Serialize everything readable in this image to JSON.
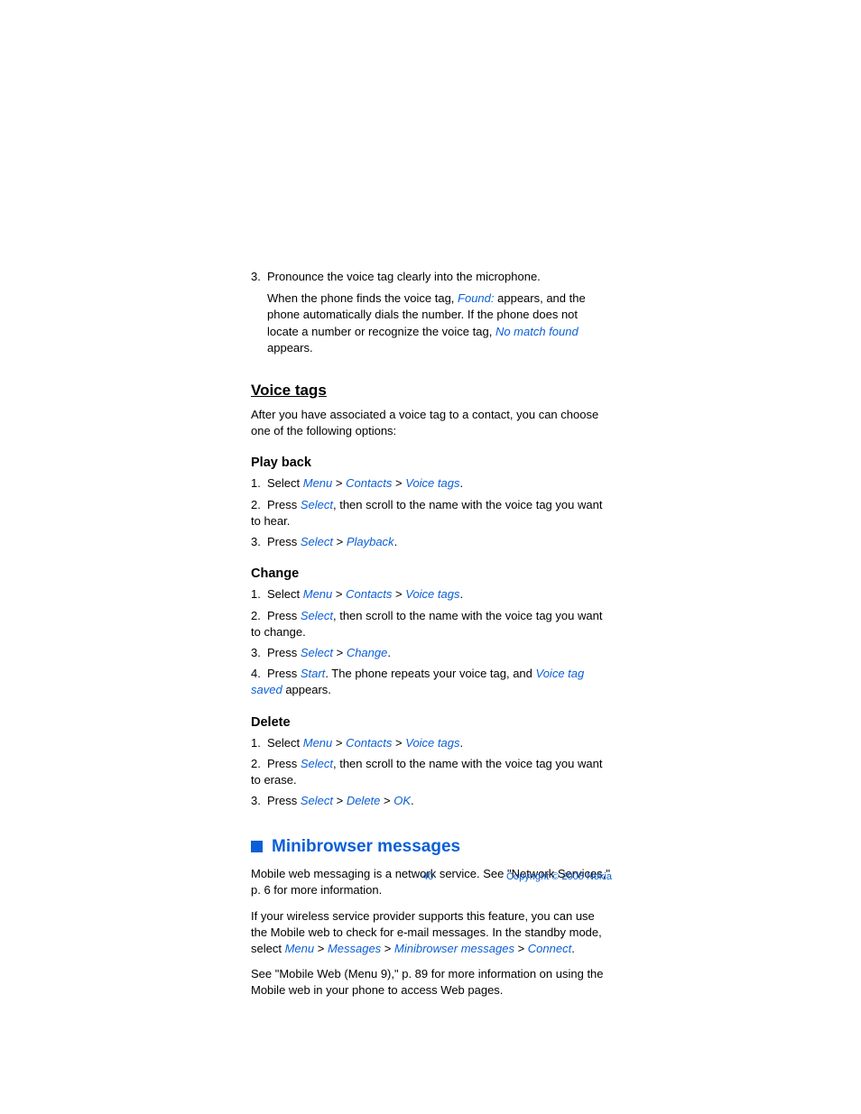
{
  "step3": {
    "num": "3.",
    "text": "Pronounce the voice tag clearly into the microphone.",
    "body_a": "When the phone finds the voice tag, ",
    "found": "Found:",
    "body_b": " appears, and the phone automatically dials the number. If the phone does not locate a number or recognize the voice tag, ",
    "nomatch": "No match found",
    "body_c": " appears."
  },
  "voice_tags": {
    "heading": "Voice tags",
    "intro": "After you have associated a voice tag to a contact, you can choose one of the following options:"
  },
  "playback": {
    "heading": "Play back",
    "s1": {
      "num": "1.",
      "a": "Select ",
      "menu": "Menu",
      "gt1": " > ",
      "contacts": "Contacts",
      "gt2": " > ",
      "vt": "Voice tags",
      "dot": "."
    },
    "s2": {
      "num": "2.",
      "a": "Press ",
      "sel": "Select",
      "b": ", then scroll to the name with the voice tag you want to hear."
    },
    "s3": {
      "num": "3.",
      "a": "Press ",
      "sel": "Select",
      "gt": " > ",
      "pb": "Playback",
      "dot": "."
    }
  },
  "change": {
    "heading": "Change",
    "s1": {
      "num": "1.",
      "a": "Select ",
      "menu": "Menu",
      "gt1": " > ",
      "contacts": "Contacts",
      "gt2": " > ",
      "vt": "Voice tags",
      "dot": "."
    },
    "s2": {
      "num": "2.",
      "a": "Press ",
      "sel": "Select",
      "b": ", then scroll to the name with the voice tag you want to change."
    },
    "s3": {
      "num": "3.",
      "a": "Press ",
      "sel": "Select",
      "gt": " > ",
      "ch": "Change",
      "dot": "."
    },
    "s4": {
      "num": "4.",
      "a": "Press ",
      "start": "Start",
      "b": ". The phone repeats your voice tag, and ",
      "saved": "Voice tag saved",
      "c": " appears."
    }
  },
  "delete": {
    "heading": "Delete",
    "s1": {
      "num": "1.",
      "a": "Select ",
      "menu": "Menu",
      "gt1": " > ",
      "contacts": "Contacts",
      "gt2": " > ",
      "vt": "Voice tags",
      "dot": "."
    },
    "s2": {
      "num": "2.",
      "a": "Press ",
      "sel": "Select",
      "b": ", then scroll to the name with the voice tag you want to erase."
    },
    "s3": {
      "num": "3.",
      "a": "Press ",
      "sel": "Select",
      "gt1": " > ",
      "del": "Delete",
      "gt2": " > ",
      "ok": "OK",
      "dot": "."
    }
  },
  "mini": {
    "heading": "Minibrowser messages",
    "p1": "Mobile web messaging is a network service. See \"Network Services,\" p. 6 for more information.",
    "p2a": "If your wireless service provider supports this feature, you can use the Mobile web to check for e-mail messages. In the standby mode, select ",
    "menu": "Menu",
    "gt1": " > ",
    "messages": "Messages",
    "gt2": " > ",
    "mbm": "Minibrowser messages",
    "gt3": " > ",
    "connect": "Connect",
    "dot": ".",
    "p3": "See \"Mobile Web (Menu 9),\" p. 89 for more information on using the Mobile web in your phone to access Web pages."
  },
  "footer": {
    "page": "40",
    "copyright": "Copyright © 2005 Nokia"
  }
}
